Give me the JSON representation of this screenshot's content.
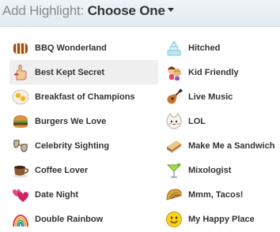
{
  "header": {
    "title": "Add Highlight:",
    "select_label": "Choose One"
  },
  "highlights_left": [
    {
      "label": "BBQ Wonderland",
      "icon": "ribs-icon"
    },
    {
      "label": "Best Kept Secret",
      "icon": "shush-hand-icon",
      "selected": true
    },
    {
      "label": "Breakfast of Champions",
      "icon": "eggs-icon"
    },
    {
      "label": "Burgers We Love",
      "icon": "burger-icon"
    },
    {
      "label": "Celebrity Sighting",
      "icon": "sunglasses-icon"
    },
    {
      "label": "Coffee Lover",
      "icon": "coffee-cup-icon"
    },
    {
      "label": "Date Night",
      "icon": "hearts-icon"
    },
    {
      "label": "Double Rainbow",
      "icon": "rainbow-icon"
    }
  ],
  "highlights_right": [
    {
      "label": "Hitched",
      "icon": "wedding-cake-icon"
    },
    {
      "label": "Kid Friendly",
      "icon": "kids-icon"
    },
    {
      "label": "Live Music",
      "icon": "guitar-icon"
    },
    {
      "label": "LOL",
      "icon": "cat-face-icon"
    },
    {
      "label": "Make Me a Sandwich",
      "icon": "sandwich-icon"
    },
    {
      "label": "Mixologist",
      "icon": "cocktail-icon"
    },
    {
      "label": "Mmm, Tacos!",
      "icon": "taco-icon"
    },
    {
      "label": "My Happy Place",
      "icon": "smiley-icon"
    }
  ]
}
